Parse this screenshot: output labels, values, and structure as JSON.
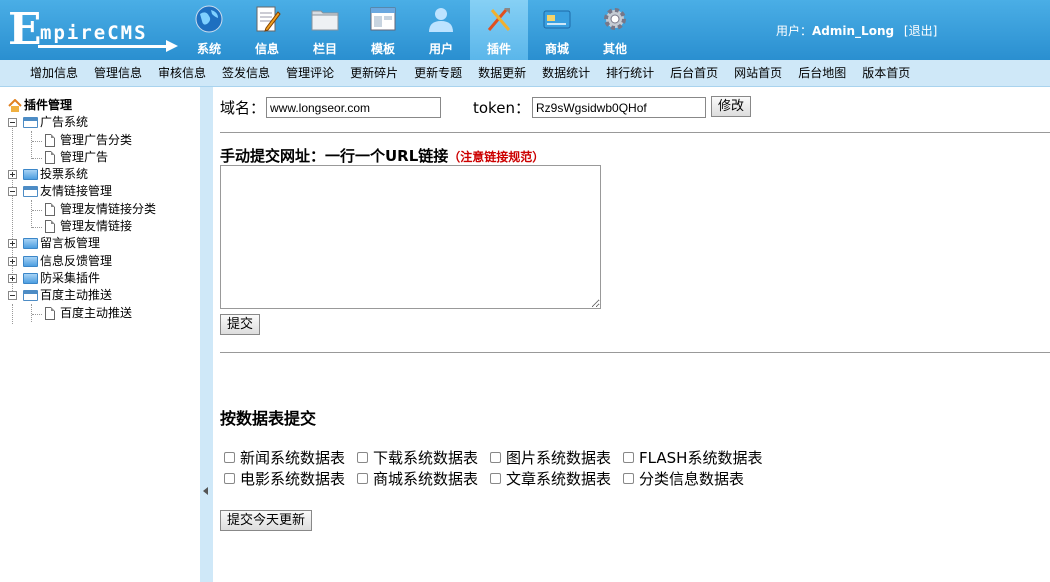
{
  "logo": {
    "big": "E",
    "rest": "mpireCMS"
  },
  "nav": [
    {
      "label": "系统",
      "icon": "globe-icon"
    },
    {
      "label": "信息",
      "icon": "notepad-icon"
    },
    {
      "label": "栏目",
      "icon": "folder-icon"
    },
    {
      "label": "模板",
      "icon": "window-icon"
    },
    {
      "label": "用户",
      "icon": "user-icon"
    },
    {
      "label": "插件",
      "icon": "tools-icon"
    },
    {
      "label": "商城",
      "icon": "card-icon"
    },
    {
      "label": "其他",
      "icon": "gear-icon"
    }
  ],
  "user": {
    "prefix": "用户：",
    "name": "Admin_Long",
    "logout": "[退出]"
  },
  "submenu": [
    "增加信息",
    "管理信息",
    "审核信息",
    "签发信息",
    "管理评论",
    "更新碎片",
    "更新专题",
    "数据更新",
    "数据统计",
    "排行统计",
    "后台首页",
    "网站首页",
    "后台地图",
    "版本首页"
  ],
  "tree": {
    "root": "插件管理",
    "items": [
      {
        "label": "广告系统",
        "level": 0,
        "open": true
      },
      {
        "label": "管理广告分类",
        "level": 1
      },
      {
        "label": "管理广告",
        "level": 1
      },
      {
        "label": "投票系统",
        "level": 0,
        "open": false
      },
      {
        "label": "友情链接管理",
        "level": 0,
        "open": true
      },
      {
        "label": "管理友情链接分类",
        "level": 1
      },
      {
        "label": "管理友情链接",
        "level": 1
      },
      {
        "label": "留言板管理",
        "level": 0,
        "open": false
      },
      {
        "label": "信息反馈管理",
        "level": 0,
        "open": false
      },
      {
        "label": "防采集插件",
        "level": 0,
        "open": false
      },
      {
        "label": "百度主动推送",
        "level": 0,
        "open": true
      },
      {
        "label": "百度主动推送",
        "level": 1
      }
    ]
  },
  "form": {
    "domain_label": "域名：",
    "domain_value": "www.longseor.com",
    "token_label": "token：",
    "token_value": "Rz9sWgsidwb0QHof",
    "modify_button": "修改",
    "manual_title": "手动提交网址：一行一个URL链接",
    "manual_note": "（注意链接规范）",
    "submit_button": "提交",
    "table_title": "按数据表提交",
    "tables": [
      [
        "新闻系统数据表",
        "下载系统数据表",
        "图片系统数据表",
        "FLASH系统数据表"
      ],
      [
        "电影系统数据表",
        "商城系统数据表",
        "文章系统数据表",
        "分类信息数据表"
      ]
    ],
    "submit_today_button": "提交今天更新"
  },
  "colors": {
    "header": "#2a8fd0",
    "submenu": "#cfe8f8",
    "note": "#cc0000"
  }
}
